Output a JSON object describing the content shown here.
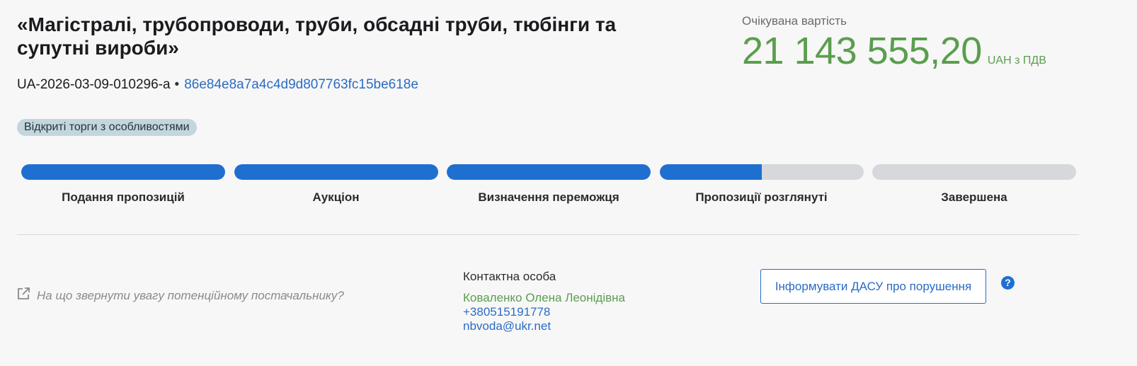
{
  "tender": {
    "title": "«Магістралі, трубопроводи, труби, обсадні труби, тюбінги та супутні вироби»",
    "id": "UA-2026-03-09-010296-a",
    "separator": "•",
    "hash": "86e84e8a7a4c4d9d807763fc15be618e",
    "procedure_type": "Відкриті торги з особливостями"
  },
  "expected_value": {
    "label": "Очікувана вартість",
    "amount": "21 143 555,20",
    "currency": "UAH з ПДВ"
  },
  "stages": [
    {
      "label": "Подання пропозицій",
      "progress": 1.0
    },
    {
      "label": "Аукціон",
      "progress": 1.0
    },
    {
      "label": "Визначення переможця",
      "progress": 1.0
    },
    {
      "label": "Пропозиції розглянуті",
      "progress": 0.5
    },
    {
      "label": "Завершена",
      "progress": 0.0
    }
  ],
  "hint": {
    "text": "На що звернути увагу потенційному постачальнику?"
  },
  "contact": {
    "heading": "Контактна особа",
    "name": "Коваленко Олена Леонідівна",
    "phone": "+380515191778",
    "email": "nbvoda@ukr.net"
  },
  "actions": {
    "dasu_button": "Інформувати ДАСУ про порушення",
    "help_icon": "?"
  },
  "colors": {
    "accent_blue": "#1f6fd1",
    "link_blue": "#2b6cc4",
    "value_green": "#5a9e4e",
    "badge_bg": "#c3d6de",
    "bar_empty": "#d6d8dc"
  }
}
